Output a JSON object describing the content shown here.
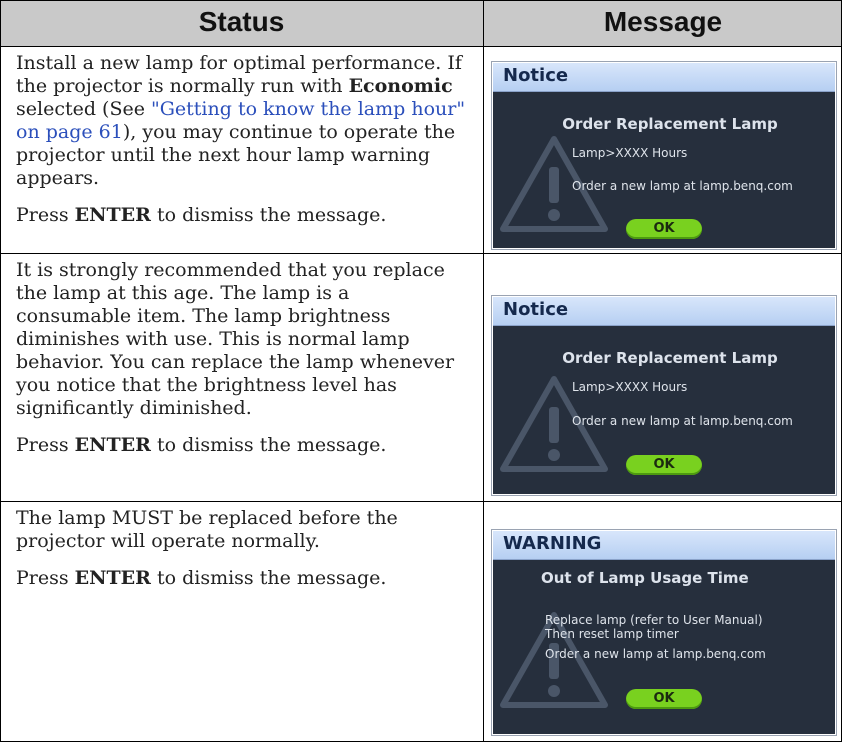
{
  "table": {
    "headers": {
      "status": "Status",
      "message": "Message"
    },
    "rows": [
      {
        "status": {
          "p1_a": "Install a new lamp for optimal performance. If the projector is normally run with ",
          "p1_bold": "Economic",
          "p1_b": " selected (See ",
          "p1_link": "\"Getting to know the lamp hour\" on page 61",
          "p1_c": "), you may continue to operate the projector until the next hour lamp warning appears.",
          "p2_a": "Press ",
          "p2_bold": "ENTER",
          "p2_b": " to dismiss the message."
        },
        "message": {
          "header": "Notice",
          "title": "Order Replacement Lamp",
          "line1": "Lamp>XXXX Hours",
          "line2": "Order a new lamp at lamp.benq.com",
          "ok": "OK"
        }
      },
      {
        "status": {
          "p1": "It is strongly recommended that you replace the lamp at this age. The lamp is a consumable item. The lamp brightness diminishes with use. This is normal lamp behavior. You can replace the lamp whenever you notice that the brightness level has significantly diminished.",
          "p2_a": "Press ",
          "p2_bold": "ENTER",
          "p2_b": " to dismiss the message."
        },
        "message": {
          "header": "Notice",
          "title": "Order Replacement Lamp",
          "line1": "Lamp>XXXX Hours",
          "line2": "Order a new lamp at lamp.benq.com",
          "ok": "OK"
        }
      },
      {
        "status": {
          "p1": "The lamp MUST be replaced before the projector will operate normally.",
          "p2_a": "Press ",
          "p2_bold": "ENTER",
          "p2_b": " to dismiss the message."
        },
        "message": {
          "header": "WARNING",
          "title": "Out of Lamp Usage Time",
          "line1": "Replace lamp (refer to User Manual)",
          "line2": "Then reset lamp timer",
          "line3": "Order a new lamp at lamp.benq.com",
          "ok": "OK"
        }
      }
    ]
  }
}
